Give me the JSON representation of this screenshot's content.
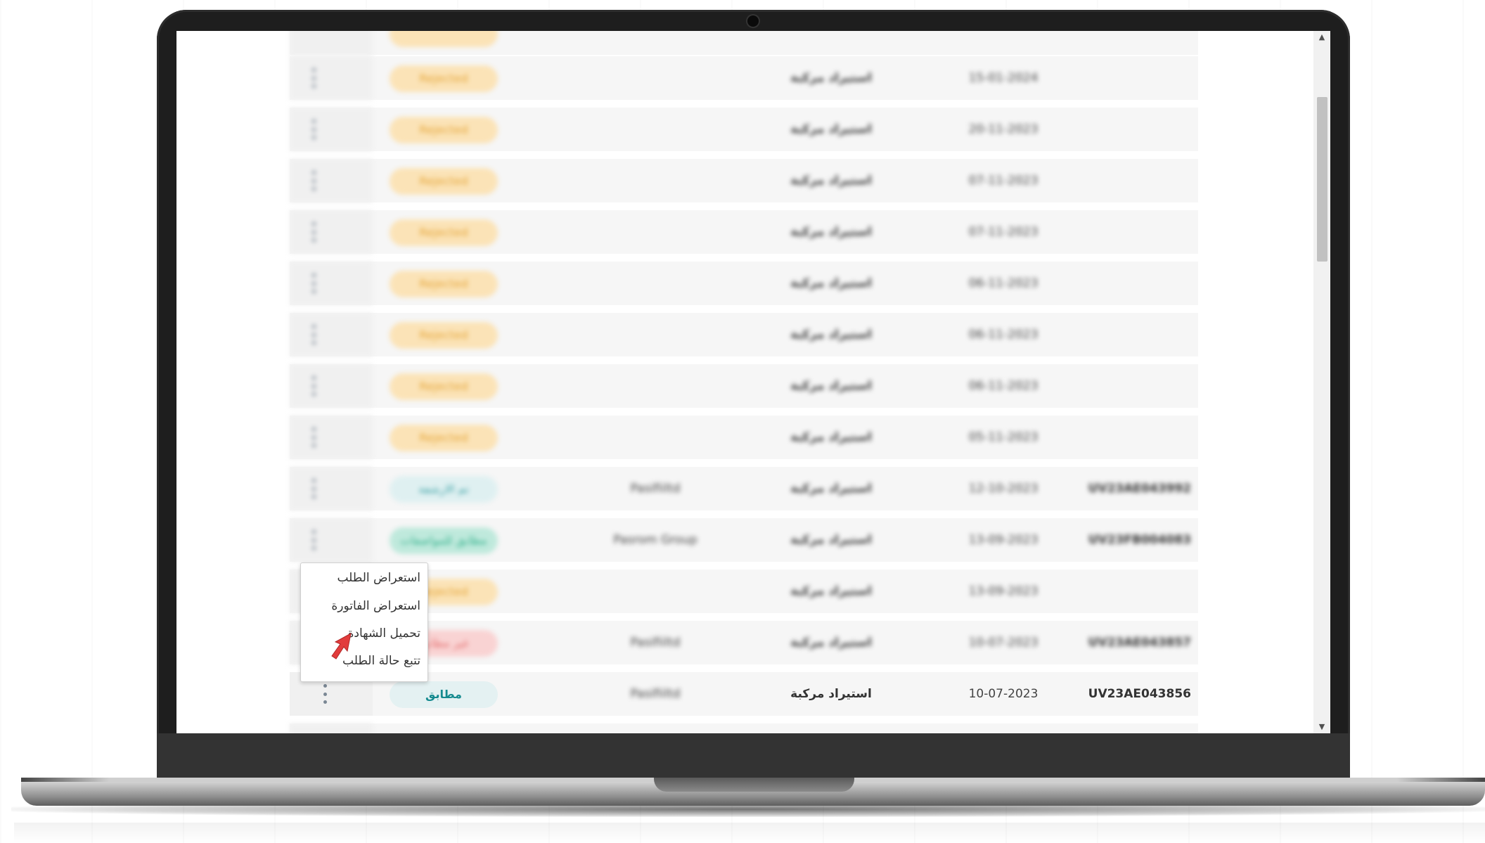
{
  "table": {
    "rows": [
      {
        "status": "Rejected",
        "status_color": "orange",
        "name": "",
        "type": "استيراد مركبة",
        "date": "15-01-2024",
        "id": ""
      },
      {
        "status": "Rejected",
        "status_color": "orange",
        "name": "",
        "type": "استيراد مركبة",
        "date": "20-11-2023",
        "id": ""
      },
      {
        "status": "Rejected",
        "status_color": "orange",
        "name": "",
        "type": "استيراد مركبة",
        "date": "07-11-2023",
        "id": ""
      },
      {
        "status": "Rejected",
        "status_color": "orange",
        "name": "",
        "type": "استيراد مركبة",
        "date": "07-11-2023",
        "id": ""
      },
      {
        "status": "Rejected",
        "status_color": "orange",
        "name": "",
        "type": "استيراد مركبة",
        "date": "06-11-2023",
        "id": ""
      },
      {
        "status": "Rejected",
        "status_color": "orange",
        "name": "",
        "type": "استيراد مركبة",
        "date": "06-11-2023",
        "id": ""
      },
      {
        "status": "Rejected",
        "status_color": "orange",
        "name": "",
        "type": "استيراد مركبة",
        "date": "06-11-2023",
        "id": ""
      },
      {
        "status": "Rejected",
        "status_color": "orange",
        "name": "",
        "type": "استيراد مركبة",
        "date": "05-11-2023",
        "id": ""
      },
      {
        "status": "تم الارشفة",
        "status_color": "teal",
        "name": "Pasifiiltd",
        "type": "استيراد مركبة",
        "date": "12-10-2023",
        "id": "UV23AE043992"
      },
      {
        "status": "مطابق للمواصفات",
        "status_color": "green",
        "name": "Pasrom Group",
        "type": "استيراد مركبة",
        "date": "13-09-2023",
        "id": "UV23FB004083"
      },
      {
        "status": "Rejected",
        "status_color": "orange",
        "name": "",
        "type": "استيراد مركبة",
        "date": "13-09-2023",
        "id": ""
      },
      {
        "status": "غير مطابق",
        "status_color": "red",
        "name": "Pasifiiltd",
        "type": "استيراد مركبة",
        "date": "10-07-2023",
        "id": "UV23AE043857"
      },
      {
        "status": "مطابق",
        "status_color": "clear",
        "name": "Pasifiiltd",
        "type": "استيراد مركبة",
        "date": "10-07-2023",
        "id": "UV23AE043856"
      }
    ]
  },
  "menu": {
    "items": [
      {
        "label": "استعراض الطلب"
      },
      {
        "label": "استعراض الفاتورة"
      },
      {
        "label": "تحميل الشهادة"
      },
      {
        "label": "تتبع حالة الطلب"
      }
    ]
  },
  "colors": {
    "accent_teal": "#158a8f",
    "cursor_red": "#e23c3c"
  }
}
